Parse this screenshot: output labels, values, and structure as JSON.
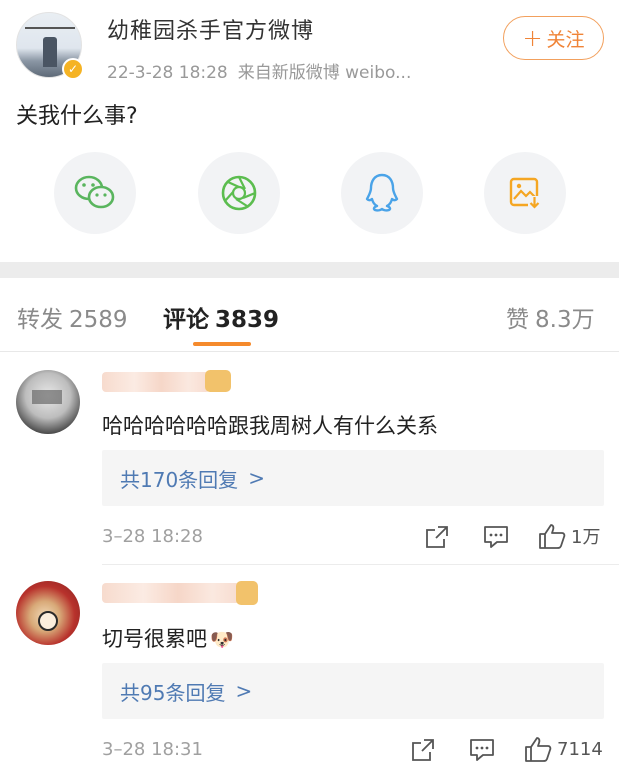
{
  "post": {
    "author": "幼稚园杀手官方微博",
    "date": "22-3-28 18:28",
    "source": "来自新版微博 weibo...",
    "follow_label": "关注",
    "text": "关我什么事?"
  },
  "share": {
    "icons": [
      "wechat-icon",
      "moments-icon",
      "qq-icon",
      "save-image-icon"
    ],
    "colors": {
      "wechat": "#5ab55e",
      "moments": "#5cbd4f",
      "qq": "#4aa3e8",
      "save": "#f5a623"
    }
  },
  "tabs": {
    "repost_label": "转发",
    "repost_count": "2589",
    "comment_label": "评论",
    "comment_count": "3839",
    "like_label": "赞",
    "like_count": "8.3万",
    "accent": "#f58a2c"
  },
  "comments": [
    {
      "text": "哈哈哈哈哈哈跟我周树人有什么关系",
      "replies": "共170条回复",
      "time": "3–28 18:28",
      "likes": "1万"
    },
    {
      "text": "切号很累吧",
      "emoji": "🐶",
      "replies": "共95条回复",
      "time": "3–28 18:31",
      "likes": "7114"
    }
  ]
}
